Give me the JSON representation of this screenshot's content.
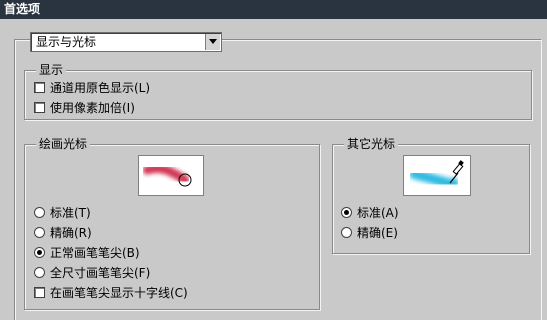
{
  "title": "首选项",
  "section_dropdown": {
    "selected": "显示与光标"
  },
  "display_group": {
    "title": "显示",
    "options": [
      {
        "label": "通道用原色显示(L)",
        "checked": false
      },
      {
        "label": "使用像素加倍(I)",
        "checked": false
      }
    ]
  },
  "painting_cursors": {
    "title": "绘画光标",
    "options": [
      {
        "label": "标准(T)",
        "selected": false
      },
      {
        "label": "精确(R)",
        "selected": false
      },
      {
        "label": "正常画笔笔尖(B)",
        "selected": true
      },
      {
        "label": "全尺寸画笔笔尖(F)",
        "selected": false
      }
    ],
    "crosshair_checkbox": {
      "label": "在画笔笔尖显示十字线(C)",
      "checked": false
    },
    "preview_stroke_color": "#cc2244"
  },
  "other_cursors": {
    "title": "其它光标",
    "options": [
      {
        "label": "标准(A)",
        "selected": true
      },
      {
        "label": "精确(E)",
        "selected": false
      }
    ],
    "preview_stroke_color": "#22b8e0"
  }
}
